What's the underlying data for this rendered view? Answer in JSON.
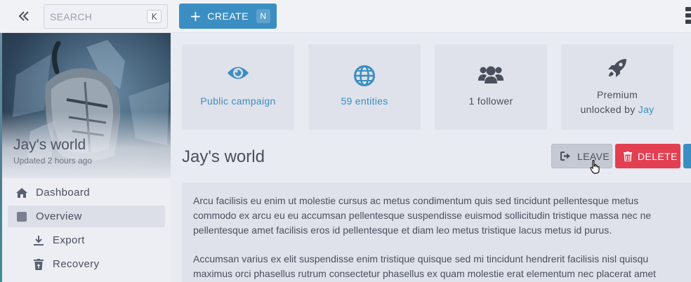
{
  "topbar": {
    "search_placeholder": "SEARCH",
    "search_shortcut": "K",
    "create_label": "CREATE",
    "create_shortcut": "N",
    "icons": [
      "chevrons-left-icon",
      "plus-icon",
      "kebab-menu-icon"
    ]
  },
  "sidebar": {
    "world_name": "Jay's world",
    "updated": "Updated 2 hours ago",
    "items": [
      {
        "label": "Dashboard",
        "icon": "home-icon",
        "active": false
      },
      {
        "label": "Overview",
        "icon": "square-icon",
        "active": true
      },
      {
        "label": "Export",
        "icon": "download-icon",
        "active": false
      },
      {
        "label": "Recovery",
        "icon": "trash-restore-icon",
        "active": false
      }
    ]
  },
  "stats": [
    {
      "label": "Public campaign",
      "icon": "eye-icon"
    },
    {
      "label": "59 entities",
      "icon": "globe-icon"
    },
    {
      "label": "1 follower",
      "icon": "users-icon"
    },
    {
      "label_prefix": "Premium",
      "label_middle": "unlocked by",
      "label_link": "Jay",
      "icon": "rocket-icon"
    }
  ],
  "main": {
    "title": "Jay's world",
    "leave_label": "LEAVE",
    "delete_label": "DELETE",
    "paragraphs": [
      [
        "Arcu facilisis eu enim ut molestie cursus ac metus condimentum quis sed tincidunt pellentesque metus",
        "commodo ex arcu eu eu accumsan pellentesque suspendisse euismod sollicitudin tristique massa nec ne",
        "pellentesque amet facilisis eros id pellentesque et diam leo metus tristique lacus metus id purus."
      ],
      [
        "Accumsan varius ex elit suspendisse enim tristique quisque sed mi tincidunt hendrerit facilisis nisl quisqu",
        "maximus orci phasellus rutrum consectetur phasellus ex quam molestie erat elementum nec placerat amet"
      ]
    ]
  },
  "colors": {
    "accent": "#3b8ec2",
    "danger": "#e23f52",
    "neutral_button": "#c5c9d3",
    "card_bg": "#dfe2ea",
    "page_bg": "#e9ebf2"
  }
}
